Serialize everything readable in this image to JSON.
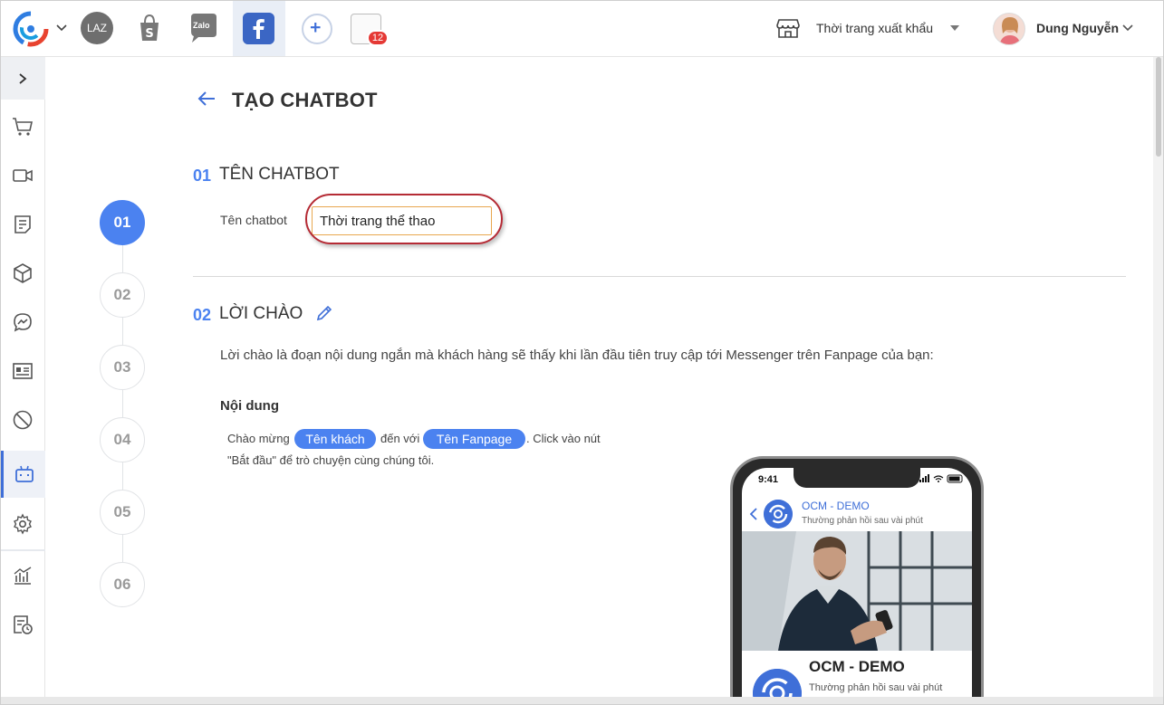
{
  "topbar": {
    "channels": {
      "lazada": {
        "label": "LAZ"
      },
      "zalo": {
        "label": "Zalo"
      },
      "notification_count": "12"
    },
    "store": {
      "name": "Thời trang xuất khẩu"
    },
    "user": {
      "name": "Dung Nguyễn"
    }
  },
  "page": {
    "title": "TẠO CHATBOT"
  },
  "steps": [
    "01",
    "02",
    "03",
    "04",
    "05",
    "06"
  ],
  "section1": {
    "number": "01",
    "title": "TÊN CHATBOT",
    "field_label": "Tên chatbot",
    "field_value": "Thời trang thể thao"
  },
  "section2": {
    "number": "02",
    "title": "LỜI CHÀO",
    "description": "Lời chào là đoạn nội dung ngắn mà khách hàng sẽ thấy khi lần đầu tiên truy cập tới Messenger trên Fanpage của bạn:",
    "content_label": "Nội dung",
    "message": {
      "part1": "Chào mừng",
      "chip_guest": "Tên khách",
      "part2": "đến với",
      "chip_fanpage": "Tên Fanpage",
      "part3": ". Click vào nút",
      "line2": "\"Bắt đầu\" để trò chuyện cùng chúng tôi."
    }
  },
  "phone_preview": {
    "time": "9:41",
    "page_name": "OCM - DEMO",
    "reply_hint": "Thường phản hồi sau vài phút",
    "card_title": "OCM - DEMO",
    "card_subtitle": "Thường phản hồi sau vài phút"
  },
  "colors": {
    "accent": "#4b82f0",
    "highlight_ring": "#b52b35",
    "input_border": "#e8a74f"
  }
}
